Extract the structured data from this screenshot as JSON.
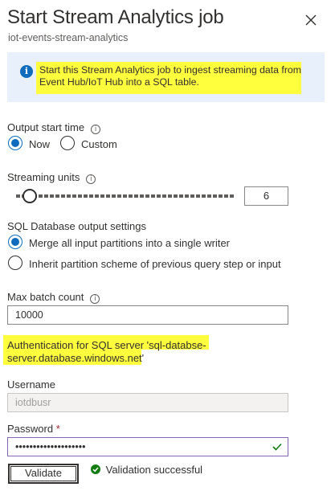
{
  "header": {
    "title": "Start Stream Analytics job",
    "subtitle": "iot-events-stream-analytics",
    "close_icon": "close-icon"
  },
  "info": {
    "icon": "info-icon",
    "text": "Start this Stream Analytics job to ingest streaming data from Event Hub/IoT Hub into a SQL table."
  },
  "output_start_time": {
    "label": "Output start time",
    "options": [
      {
        "label": "Now",
        "selected": true
      },
      {
        "label": "Custom",
        "selected": false
      }
    ]
  },
  "streaming_units": {
    "label": "Streaming units",
    "value": "6"
  },
  "sql_output": {
    "label": "SQL Database output settings",
    "options": [
      {
        "label": "Merge all input partitions into a single writer",
        "selected": true
      },
      {
        "label": "Inherit partition scheme of previous query step or input",
        "selected": false
      }
    ]
  },
  "max_batch": {
    "label": "Max batch count",
    "value": "10000"
  },
  "auth": {
    "text": "Authentication for SQL server 'sql-databse-server.database.windows.net'"
  },
  "username": {
    "label": "Username",
    "value": "iotdbusr"
  },
  "password": {
    "label": "Password",
    "required_marker": "*",
    "value": "••••••••••••••••••••"
  },
  "validate": {
    "button_label": "Validate",
    "status_text": "Validation successful"
  },
  "colors": {
    "accent": "#0f6cbd",
    "highlight": "#ffff3d",
    "success": "#107c10",
    "info_bg": "#e8f1fb"
  }
}
